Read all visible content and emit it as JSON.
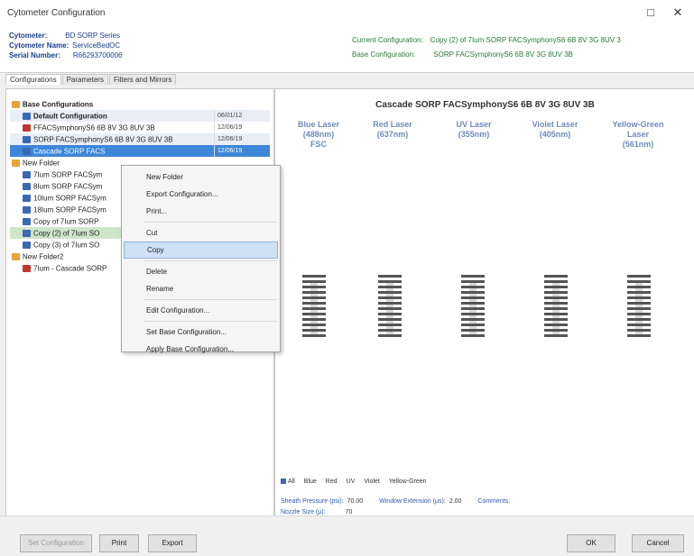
{
  "window": {
    "title": "Cytometer Configuration",
    "minimize": "□",
    "close": "✕"
  },
  "info": {
    "cytometer_label": "Cytometer:",
    "cytometer_value": "BD SORP Series",
    "name_label": "Cytometer Name:",
    "name_value": "ServiceBedOC",
    "serial_label": "Serial Number:",
    "serial_value": "R66293700006",
    "current_label": "Current Configuration:",
    "current_value": "Copy (2) of 7Ium SORP FACSymphonyS6 6B 8V 3G 8UV 3",
    "base_label": "Base Configuration:",
    "base_value": "SORP FACSymphonyS6 6B 8V 3G 8UV 3B"
  },
  "tabs": [
    "Configurations",
    "Parameters",
    "Filters and Mirrors"
  ],
  "tree": [
    {
      "label": "Base Configurations",
      "icon": "folder",
      "level": 0,
      "state": "grp"
    },
    {
      "label": "Default Configuration",
      "icon": "cfg",
      "level": 1,
      "state": "grp shade",
      "date": "06/01/12"
    },
    {
      "label": "FFACSymphonyS6 6B 8V 3G 8UV 3B",
      "icon": "cfgr",
      "level": 1,
      "state": "",
      "date": "12/06/19"
    },
    {
      "label": "SORP FACSymphonyS6 6B 8V 3G 8UV 3B",
      "icon": "cfg",
      "level": 1,
      "state": "shade",
      "date": "12/06/19"
    },
    {
      "label": "Cascade SORP FACS",
      "icon": "cfg",
      "level": 1,
      "state": "sel",
      "date": "12/06/19"
    },
    {
      "label": "New Folder",
      "icon": "folder",
      "level": 0,
      "state": ""
    },
    {
      "label": "7Ium SORP FACSym",
      "icon": "cfg",
      "level": 1,
      "state": ""
    },
    {
      "label": "8Ium SORP FACSym",
      "icon": "cfg",
      "level": 1,
      "state": ""
    },
    {
      "label": "10Ium SORP FACSym",
      "icon": "cfg",
      "level": 1,
      "state": ""
    },
    {
      "label": "18Ium SORP FACSym",
      "icon": "cfg",
      "level": 1,
      "state": ""
    },
    {
      "label": "Copy of 7Ium SORP",
      "icon": "cfg",
      "level": 1,
      "state": ""
    },
    {
      "label": "Copy (2) of 7Ium SO",
      "icon": "cfg",
      "level": 1,
      "state": "hl"
    },
    {
      "label": "Copy (3) of 7Ium SO",
      "icon": "cfg",
      "level": 1,
      "state": ""
    },
    {
      "label": "New Folder2",
      "icon": "folder",
      "level": 0,
      "state": ""
    },
    {
      "label": "7Ium - Cascade SORP",
      "icon": "cfgr",
      "level": 1,
      "state": ""
    }
  ],
  "context_menu": [
    {
      "label": "New Folder",
      "hover": false
    },
    {
      "label": "Export Configuration...",
      "hover": false
    },
    {
      "label": "Print...",
      "hover": false
    },
    {
      "sep": true
    },
    {
      "label": "Cut",
      "hover": false
    },
    {
      "label": "Copy",
      "hover": true
    },
    {
      "sep": true
    },
    {
      "label": "Delete",
      "hover": false
    },
    {
      "label": "Rename",
      "hover": false
    },
    {
      "sep": true
    },
    {
      "label": "Edit Configuration...",
      "hover": false
    },
    {
      "sep": true
    },
    {
      "label": "Set Base Configuration...",
      "hover": false
    },
    {
      "label": "Apply Base Configuration...",
      "hover": false
    }
  ],
  "config_panel": {
    "title": "Cascade SORP FACSymphonyS6 6B 8V 3G 8UV 3B",
    "lasers": [
      {
        "lines": [
          "Blue Laser",
          "(488nm)",
          "FSC"
        ]
      },
      {
        "lines": [
          "Red Laser",
          "(637nm)"
        ]
      },
      {
        "lines": [
          "UV Laser",
          "(355nm)"
        ]
      },
      {
        "lines": [
          "Violet Laser",
          "(405nm)"
        ]
      },
      {
        "lines": [
          "Yellow-Green",
          "Laser",
          "(561nm)"
        ]
      }
    ],
    "legend": [
      "All",
      "Blue",
      "Red",
      "UV",
      "Violet",
      "Yellow-Green"
    ],
    "sheath_label": "Sheath Pressure (psi):",
    "sheath_value": "70.00",
    "window_label": "Window Extension (µs):",
    "window_value": "2.00",
    "comments_label": "Comments:",
    "nozzle_label": "Nozzle Size (µ):",
    "nozzle_value": "70"
  },
  "buttons": {
    "set_configuration": "Set Configuration",
    "print": "Print",
    "export": "Export",
    "ok": "OK",
    "cancel": "Cancel"
  }
}
